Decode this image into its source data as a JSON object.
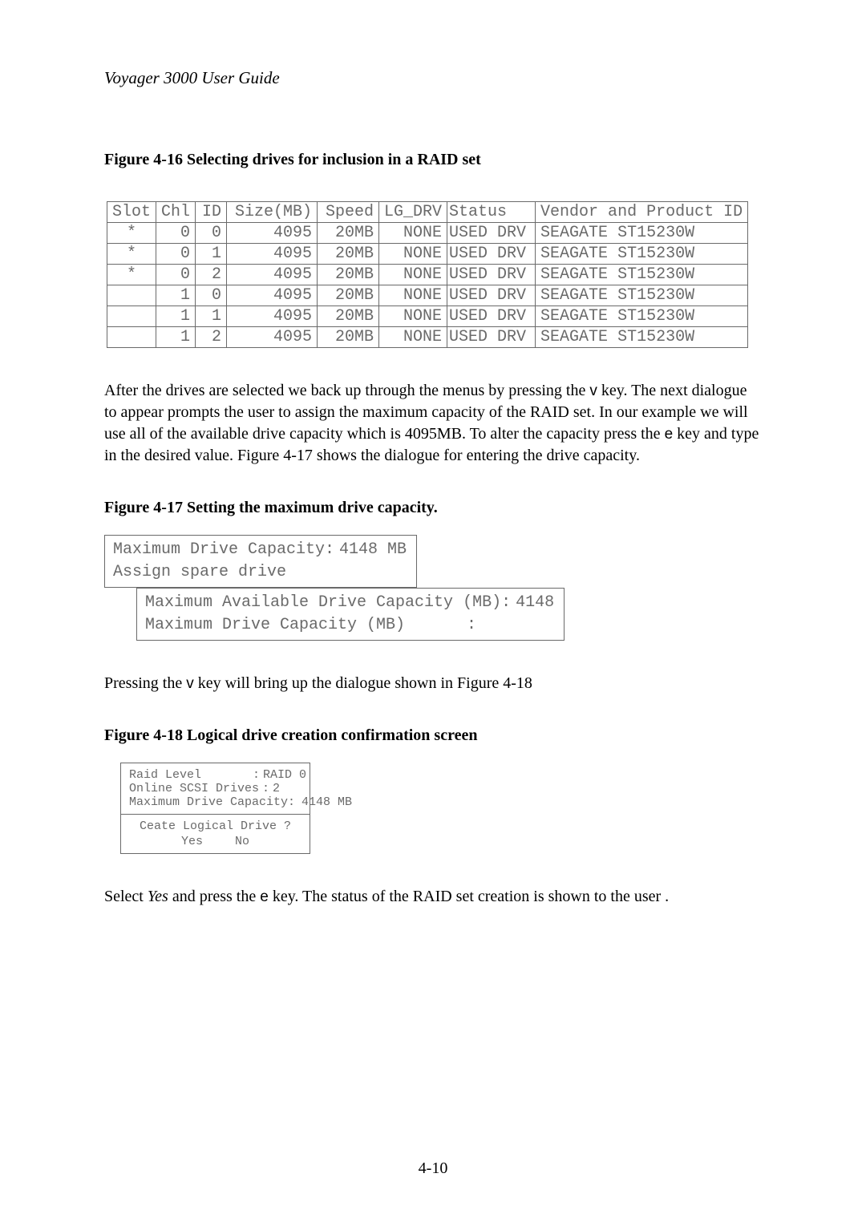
{
  "header": "Voyager 3000 User Guide",
  "page_number": "4-10",
  "figures": {
    "f16": {
      "caption": "Figure 4-16 Selecting drives for inclusion in a RAID set",
      "columns": [
        "Slot",
        "Chl",
        "ID",
        "Size(MB)",
        "Speed",
        "LG_DRV",
        "Status",
        "Vendor and Product ID"
      ],
      "rows": [
        {
          "slot": "*",
          "chl": "0",
          "id": "0",
          "size": "4095",
          "speed": "20MB",
          "lg": "NONE",
          "status": "USED DRV",
          "vendor": "SEAGATE ST15230W"
        },
        {
          "slot": "*",
          "chl": "0",
          "id": "1",
          "size": "4095",
          "speed": "20MB",
          "lg": "NONE",
          "status": "USED DRV",
          "vendor": "SEAGATE ST15230W"
        },
        {
          "slot": "*",
          "chl": "0",
          "id": "2",
          "size": "4095",
          "speed": "20MB",
          "lg": "NONE",
          "status": "USED DRV",
          "vendor": "SEAGATE ST15230W"
        },
        {
          "slot": "",
          "chl": "1",
          "id": "0",
          "size": "4095",
          "speed": "20MB",
          "lg": "NONE",
          "status": "USED DRV",
          "vendor": "SEAGATE ST15230W"
        },
        {
          "slot": "",
          "chl": "1",
          "id": "1",
          "size": "4095",
          "speed": "20MB",
          "lg": "NONE",
          "status": "USED DRV",
          "vendor": "SEAGATE ST15230W"
        },
        {
          "slot": "",
          "chl": "1",
          "id": "2",
          "size": "4095",
          "speed": "20MB",
          "lg": "NONE",
          "status": "USED DRV",
          "vendor": "SEAGATE ST15230W"
        }
      ]
    },
    "f17": {
      "caption": "Figure 4-17 Setting the maximum drive capacity.",
      "top": {
        "line1_label": "Maximum Drive Capacity:",
        "line1_value": "4148 MB",
        "line2": "Assign spare drive"
      },
      "bottom": {
        "line1_label": "Maximum Available Drive Capacity (MB):",
        "line1_value": "4148",
        "line2_label": "Maximum Drive Capacity (MB)",
        "line2_sep": ":"
      }
    },
    "f18": {
      "caption": "Figure 4-18 Logical drive creation confirmation screen",
      "upper": [
        {
          "label": "Raid Level",
          "sep": ":",
          "value": "RAID 0"
        },
        {
          "label": "Online SCSI Drives",
          "sep": ":",
          "value": "2"
        },
        {
          "label": "Maximum Drive Capacity:",
          "sep": "",
          "value": "4148 MB"
        }
      ],
      "prompt": "Ceate Logical Drive ?",
      "yes": "Yes",
      "no": "No"
    }
  },
  "paragraphs": {
    "p1_a": "After the drives are selected we back up through the menus by pressing the ",
    "p1_key_v": "v",
    "p1_b": " key. The next dialogue to appear prompts the user to assign the maximum capacity of the RAID set. In our example we will use all of the available drive capacity which is 4095MB. To alter the capacity press the ",
    "p1_key_e": "e",
    "p1_c": " key and type in the desired value. Figure 4-17 shows the dialogue for entering the drive capacity.",
    "p2_a": "Pressing the ",
    "p2_key_v": "v",
    "p2_b": " key will bring up the dialogue shown in Figure 4-18",
    "p3_a": "Select ",
    "p3_yes": "Yes",
    "p3_b": " and press the ",
    "p3_key_e": "e",
    "p3_c": " key. The status of the RAID set creation is shown to the user ."
  }
}
